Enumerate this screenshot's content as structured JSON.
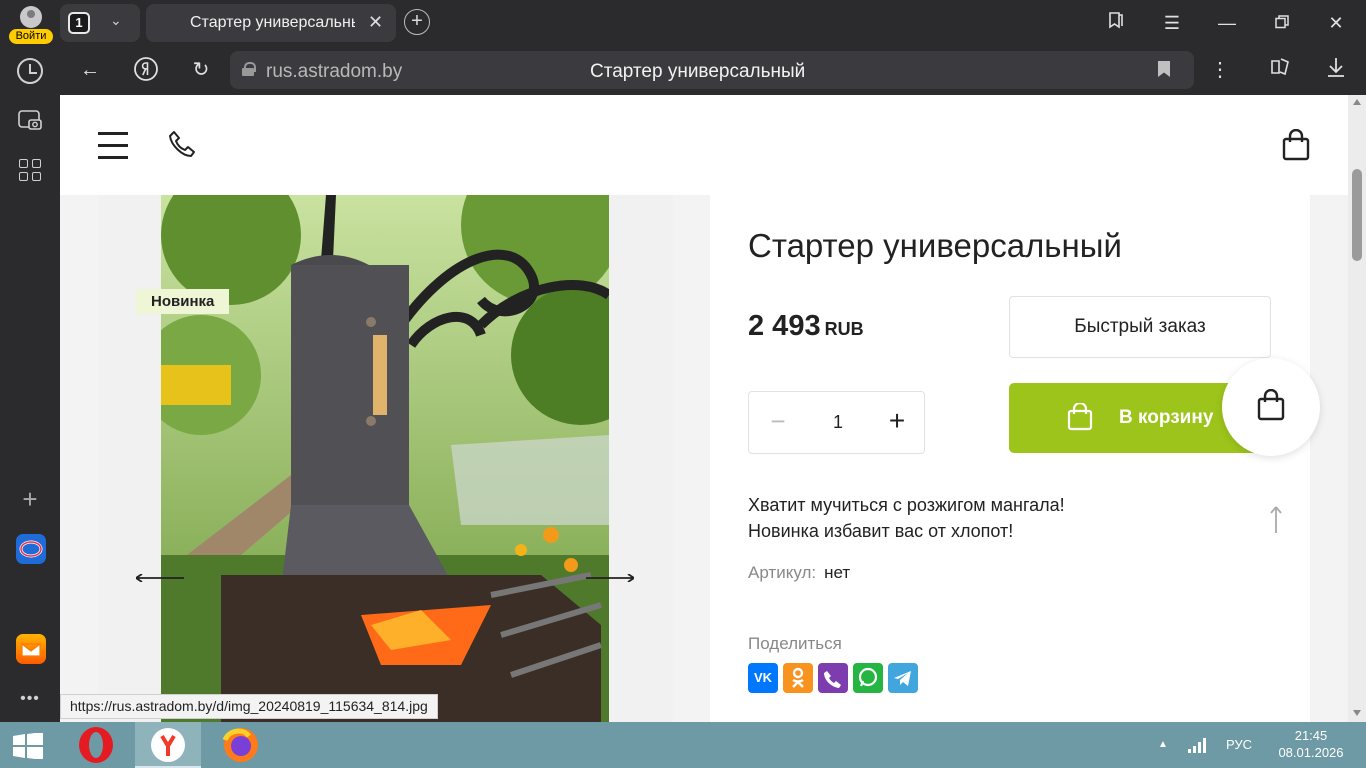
{
  "browser": {
    "profile_login": "Войти",
    "tab_count": "1",
    "tab_title": "Стартер универсальный",
    "address_domain": "rus.astradom.by",
    "address_title": "Стартер универсальный",
    "status_url": "https://rus.astradom.by/d/img_20240819_115634_814.jpg"
  },
  "product": {
    "badge": "Новинка",
    "title": "Стартер универсальный",
    "price": "2 493",
    "currency": "RUB",
    "quick_order": "Быстрый заказ",
    "quantity": "1",
    "add_to_cart": "В корзину",
    "description_line1": "Хватит мучиться с розжигом мангала!",
    "description_line2": "Новинка избавит вас от хлопот!",
    "sku_label": "Артикул:",
    "sku_value": "нет",
    "share_label": "Поделиться",
    "socials": [
      "vk-icon",
      "odnoklassniki-icon",
      "viber-icon",
      "whatsapp-icon",
      "telegram-icon"
    ]
  },
  "taskbar": {
    "lang": "РУС",
    "time": "21:45",
    "date": "08.01.2026"
  },
  "colors": {
    "accent_green": "#9dc41b",
    "badge_bg": "#eef6d6",
    "taskbar": "#6d9aa4",
    "chrome": "#2b2b2e"
  }
}
